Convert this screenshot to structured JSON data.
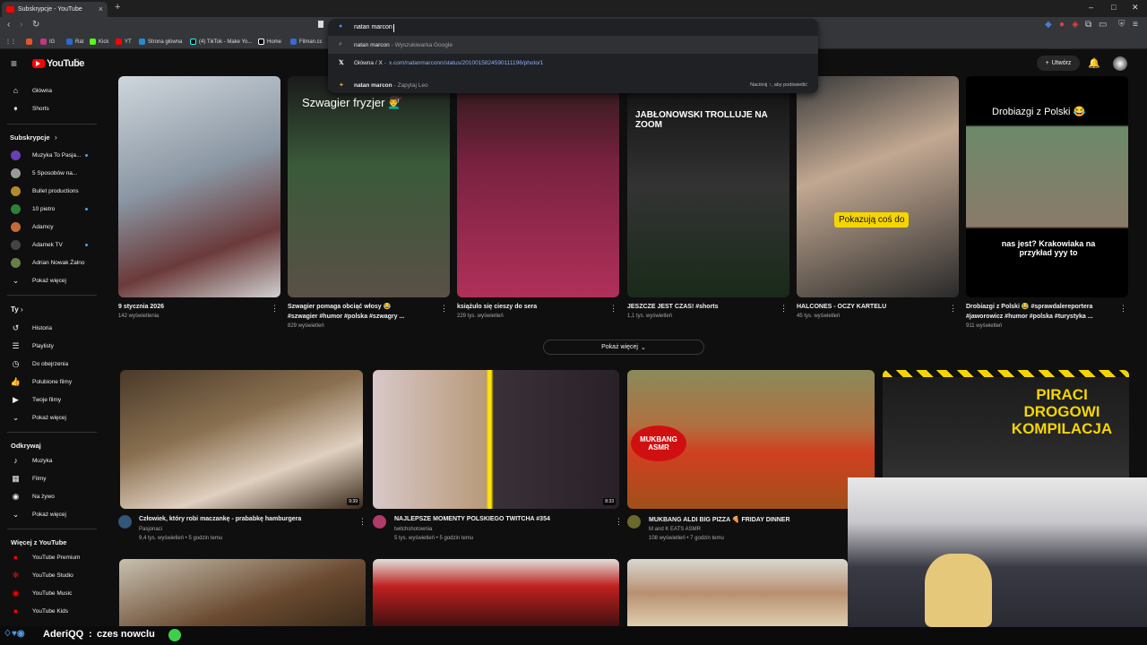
{
  "browser": {
    "tab_title": "Subskrypcje - YouTube",
    "new_tab": "+",
    "omnibox_text": "natan marcon",
    "suggestions": [
      {
        "main": "natan marcon",
        "sub": "- Wyszukiwarka Google",
        "link": "",
        "hint": ""
      },
      {
        "main": "Główna / X",
        "sub": "-",
        "link": "x.com/natanmarconn/status/2010015824590111196/photo/1",
        "hint": ""
      },
      {
        "main": "natan marcon",
        "sub": "- Zapytaj Leo",
        "link": "",
        "hint": "Naciśnij ↑, aby podświetlić"
      }
    ],
    "bookmarks": [
      "IG",
      "Rat",
      "Kick",
      "YT",
      "Strona główna",
      "(4) TikTok - Make Yo...",
      "Home",
      "Filman.cc"
    ]
  },
  "yt": {
    "logo": "YouTube",
    "region": "PL",
    "create_label": "Utwórz",
    "sidebar": {
      "main": [
        {
          "label": "Główna",
          "icon": "home-icon"
        },
        {
          "label": "Shorts",
          "icon": "shorts-icon"
        }
      ],
      "subs_head": "Subskrypcje",
      "subs": [
        {
          "label": "Muzyka To Pasja...",
          "color": "#6a3fb5",
          "dot": false
        },
        {
          "label": "5 Sposobów na...",
          "color": "#999999",
          "dot": false
        },
        {
          "label": "Bullet productions",
          "color": "#b48a2c",
          "dot": false
        },
        {
          "label": "10 pietro",
          "color": "#2f7f3a",
          "dot": true
        },
        {
          "label": "Adamcy",
          "color": "#c46a3a",
          "dot": false
        },
        {
          "label": "Adamek TV",
          "color": "#444444",
          "dot": true
        },
        {
          "label": "Adrian Nowak Żalno",
          "color": "#66804a",
          "dot": false
        }
      ],
      "show_more": "Pokaż więcej",
      "you_head": "Ty",
      "you": [
        {
          "label": "Historia",
          "icon": "history-icon"
        },
        {
          "label": "Playlisty",
          "icon": "playlist-icon"
        },
        {
          "label": "Do obejrzenia",
          "icon": "watch-later-icon"
        },
        {
          "label": "Polubione filmy",
          "icon": "like-icon"
        },
        {
          "label": "Twoje filmy",
          "icon": "your-videos-icon"
        },
        {
          "label": "Pokaż więcej",
          "icon": "chevron-down-icon"
        }
      ],
      "explore_head": "Odkrywaj",
      "explore": [
        {
          "label": "Muzyka",
          "icon": "music-icon"
        },
        {
          "label": "Filmy",
          "icon": "film-icon"
        },
        {
          "label": "Na żywo",
          "icon": "live-icon"
        },
        {
          "label": "Pokaż więcej",
          "icon": "chevron-down-icon"
        }
      ],
      "more_head": "Więcej z YouTube",
      "more": [
        {
          "label": "YouTube Premium"
        },
        {
          "label": "YouTube Studio"
        },
        {
          "label": "YouTube Music"
        },
        {
          "label": "YouTube Kids"
        }
      ]
    },
    "shorts": [
      {
        "title": "9 stycznia 2026",
        "title2": "",
        "views": "142 wyświetlenia",
        "overlay": "",
        "bg": "linear-gradient(160deg,#cfd6dc 0%,#8a96a3 45%,#6b3a3a 75%,#d0d0d0 100%)"
      },
      {
        "title": "Szwagier pomaga obciąć włosy 😂",
        "title2": "#szwagier #humor #polska #szwagry ...",
        "views": "829 wyświetleń",
        "overlay": "Szwagier fryzjer 💇‍♂️",
        "bg": "linear-gradient(180deg,#1a1a1a 0%,#3a5a3a 40%,#5a5046 100%)"
      },
      {
        "title": "książulo się cieszy do sera",
        "title2": "",
        "views": "229 tys. wyświetleń",
        "overlay": "",
        "bg": "linear-gradient(180deg,#2a1a1a 0%,#7a2240 40%,#b0305a 100%)"
      },
      {
        "title": "JESZCZE JEST CZAS! #shorts",
        "title2": "",
        "views": "1,1 tys. wyświetleń",
        "overlay": "JABŁONOWSKI TROLLUJE NA ZOOM",
        "bg": "linear-gradient(180deg,#111 0%,#333 50%,#1a2a1a 100%)"
      },
      {
        "title": "HALCONES - OCZY KARTELU",
        "title2": "",
        "views": "45 tys. wyświetleń",
        "overlay": "Pokazują coś do",
        "bg": "linear-gradient(160deg,#3a3a3a 0%,#c2a892 40%,#2a2a2a 100%)"
      },
      {
        "title": "Drobiazgi z Polski 😂 #sprawdalereportera",
        "title2": "#jaworowicz #humor #polska #turystyka ...",
        "views": "911 wyświetleń",
        "overlay": "Drobiazgi z Polski 😂",
        "overlay2": "nas jest? Krakowiaka na przykład yyy to",
        "bg": "linear-gradient(180deg,#000 0%,#000 20%,#6d8a6a 30%,#8a7a6a 60%,#000 70%,#000 100%)"
      }
    ],
    "show_more_btn": "Pokaż więcej",
    "videos": [
      {
        "title": "Człowiek, który robi maczankę - prababkę hamburgera",
        "channel": "Pasjonaci",
        "meta": "9,4 tys. wyświetleń • 5 godzin temu",
        "duration": "9:39",
        "av": "#335577",
        "bg": "linear-gradient(160deg,#4a3a2a 0%,#8a7050 40%,#e0d0c0 70%,#3a2a1a 100%)"
      },
      {
        "title": "NAJLEPSZE MOMENTY POLSKIEGO TWITCHA #354",
        "channel": "twitchshotownia",
        "meta": "5 tys. wyświetleń • 5 godzin temu",
        "duration": "8:33",
        "av": "#b03a6a",
        "bg": "linear-gradient(90deg,#d8c8c8 0%,#b89a7a 45%,#ffe600 49%,#ffe600 50%,#3a3038 52%,#2a2028 100%)"
      },
      {
        "title": "MUKBANG ALDI BIG PIZZA 🍕 FRIDAY DINNER",
        "channel": "M and K EATS ASMR",
        "meta": "108 wyświetleń • 7 godzin temu",
        "duration": "",
        "av": "#6a6a2a",
        "bg": "linear-gradient(180deg,#8a8a5a 0%,#b07040 40%,#d04020 60%,#a0501a 100%)"
      },
      {
        "title": "",
        "channel": "",
        "meta": "",
        "duration": "",
        "av": "#000",
        "overlay": "PIRACI DROGOWI KOMPILACJA",
        "bg": "linear-gradient(180deg,#1a1a1a 0%,#2a2a2a 60%,#3a3a3a 100%)"
      }
    ],
    "row3": [
      {
        "bg": "linear-gradient(160deg,#c8c0b0 0%,#6a4a30 60%,#3a2a1a 100%)"
      },
      {
        "bg": "linear-gradient(180deg,#e0e0d8 0%,#c02020 40%,#401010 100%)"
      },
      {
        "bg": "linear-gradient(180deg,#d8d8d0 0%,#b89070 50%,#e0d0b0 100%)"
      }
    ]
  },
  "chat": {
    "user": "AderiQQ",
    "sep": ":",
    "message": "czes nowclu"
  }
}
